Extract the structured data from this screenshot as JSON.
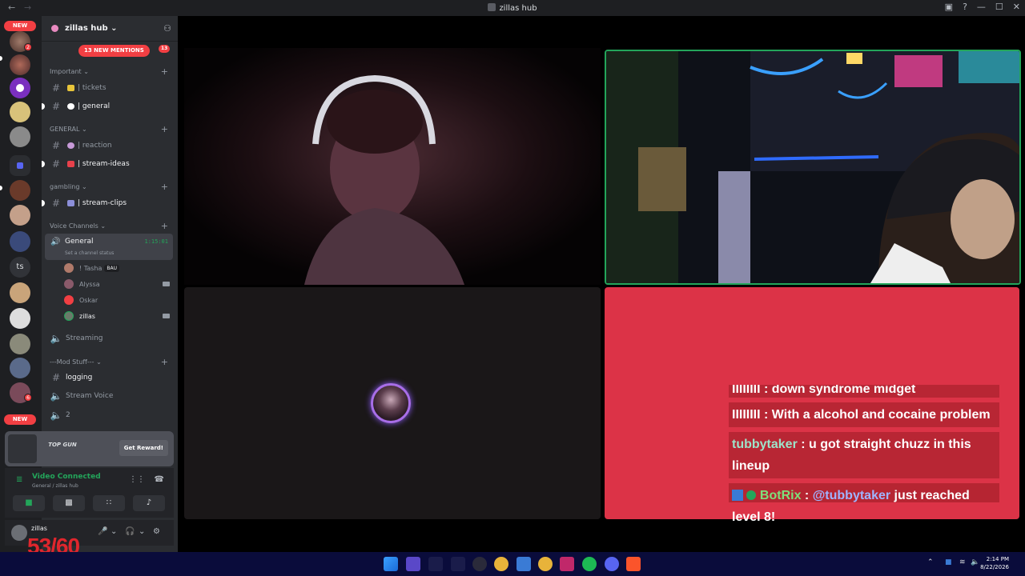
{
  "titlebar": {
    "title": "zillas hub"
  },
  "rail": {
    "new_top": "NEW",
    "new_bottom": "NEW",
    "badge_1": "2",
    "badge_2": "6",
    "ts_label": "ts"
  },
  "server": {
    "name": "zillas hub",
    "mentions_pill": "13 NEW MENTIONS",
    "mentions_count": "13"
  },
  "categories": {
    "important": "Important",
    "general": "GENERAL",
    "gambling": "gambling",
    "voice": "Voice Channels",
    "mod": "---Mod Stuff---"
  },
  "channels": {
    "tickets": "| tickets",
    "general": "| general",
    "reaction": "| reaction",
    "stream_ideas": "| stream-ideas",
    "stream_clips": "| stream-clips",
    "logging": "logging"
  },
  "voice": {
    "general": {
      "name": "General",
      "time": "1:15:01",
      "status": "Set a channel status",
      "users": [
        {
          "name": "! Tasha",
          "badge": "BAU"
        },
        {
          "name": "Alyssa"
        },
        {
          "name": "Oskar"
        },
        {
          "name": "zillas"
        }
      ]
    },
    "streaming": "Streaming",
    "stream_voice": "Stream Voice",
    "two": "2"
  },
  "promo": {
    "brand": "TOP GUN",
    "button": "Get Reward!"
  },
  "connection": {
    "status": "Video Connected",
    "location": "General / zillas hub"
  },
  "user": {
    "name": "zillas"
  },
  "overlay": {
    "fps": "53/60"
  },
  "chat": {
    "messages": [
      {
        "user": "IIIIIIII",
        "text": " : down syndrome midget",
        "color": "#ffffff"
      },
      {
        "user": "IIIIIIII",
        "text": " : With a alcohol and cocaine problem",
        "color": "#ffffff"
      },
      {
        "user": "tubbytaker",
        "text": " : u got straight chuzz in this lineup",
        "color": "#9de3c9"
      },
      {
        "user": "BotRix",
        "mention": "@tubbytaker",
        "text": " just reached level 8!",
        "color": "#7ee07a"
      }
    ]
  },
  "taskbar": {
    "time": "2:14 PM",
    "date": "8/22/2026"
  },
  "colors": {
    "accent_green": "#23a55a",
    "danger": "#f23f43",
    "tile_red": "#dc3347"
  }
}
